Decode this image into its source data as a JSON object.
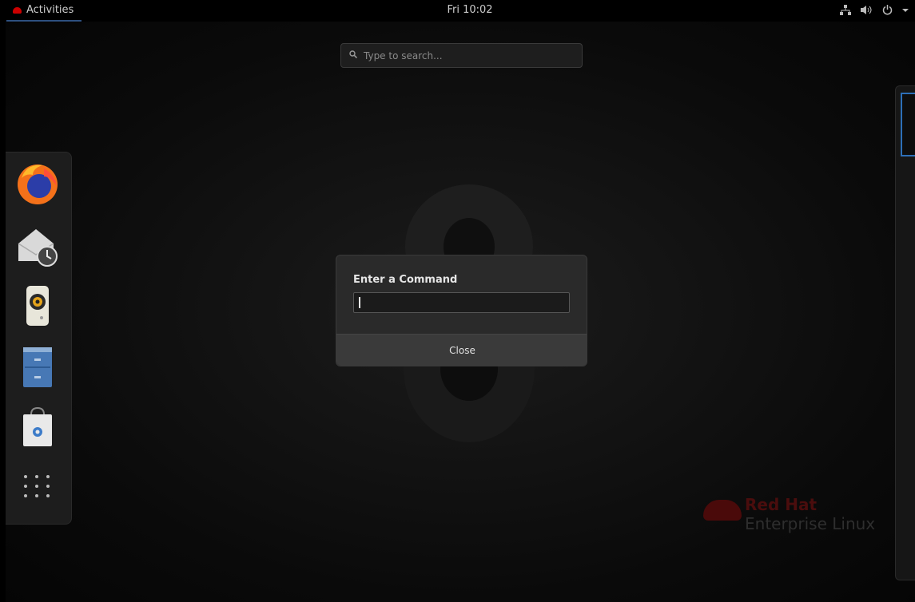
{
  "topbar": {
    "activities_label": "Activities",
    "clock": "Fri 10:02",
    "icons": [
      "network-icon",
      "volume-icon",
      "power-icon",
      "chevron-down-icon"
    ]
  },
  "search": {
    "placeholder": "Type to search...",
    "icon": "search-icon"
  },
  "dash": {
    "items": [
      {
        "name": "firefox",
        "icon": "firefox-icon"
      },
      {
        "name": "evolution",
        "icon": "mail-clock-icon"
      },
      {
        "name": "rhythmbox",
        "icon": "speaker-icon"
      },
      {
        "name": "files",
        "icon": "file-cabinet-icon"
      },
      {
        "name": "software",
        "icon": "shopping-bag-icon"
      },
      {
        "name": "show-applications",
        "icon": "app-grid-icon"
      }
    ]
  },
  "dialog": {
    "title": "Enter a Command",
    "input_value": "",
    "close_label": "Close"
  },
  "branding": {
    "line1": "Red Hat",
    "line2": "Enterprise Linux"
  },
  "colors": {
    "accent": "#2d6fb8",
    "brand_red": "#cc0000",
    "dialog_bg": "#2a2a2a"
  }
}
